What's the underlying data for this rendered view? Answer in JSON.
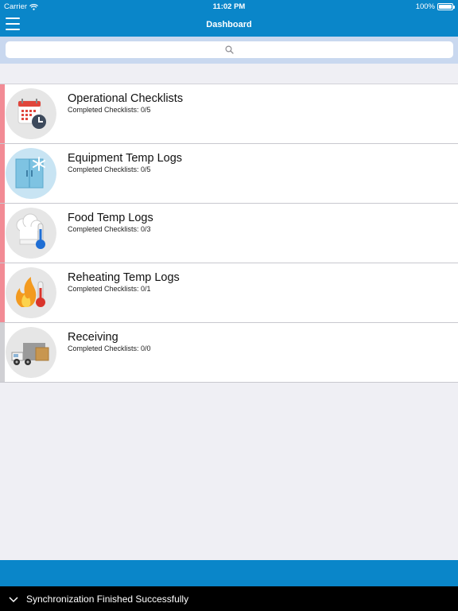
{
  "status_bar": {
    "carrier": "Carrier",
    "time": "11:02 PM",
    "battery": "100%"
  },
  "nav": {
    "title": "Dashboard"
  },
  "search": {
    "placeholder": ""
  },
  "items": [
    {
      "title": "Operational Checklists",
      "subtitle": "Completed Checklists: 0/5",
      "accent": "#f28b95",
      "icon": "calendar-clock-icon"
    },
    {
      "title": "Equipment Temp Logs",
      "subtitle": "Completed Checklists: 0/5",
      "accent": "#f28b95",
      "icon": "freezer-icon"
    },
    {
      "title": "Food Temp Logs",
      "subtitle": "Completed Checklists: 0/3",
      "accent": "#f28b95",
      "icon": "chef-hat-thermometer-icon"
    },
    {
      "title": "Reheating Temp Logs",
      "subtitle": "Completed Checklists: 0/1",
      "accent": "#f28b95",
      "icon": "flame-thermometer-icon"
    },
    {
      "title": "Receiving",
      "subtitle": "Completed Checklists: 0/0",
      "accent": "#d0d0d4",
      "icon": "delivery-truck-icon"
    }
  ],
  "toast": {
    "message": "Synchronization Finished Successfully"
  },
  "colors": {
    "brand": "#0a86c9",
    "search_bg": "#c9d8ef",
    "page_bg": "#efeff4",
    "overdue": "#f28b95",
    "neutral": "#d0d0d4"
  }
}
